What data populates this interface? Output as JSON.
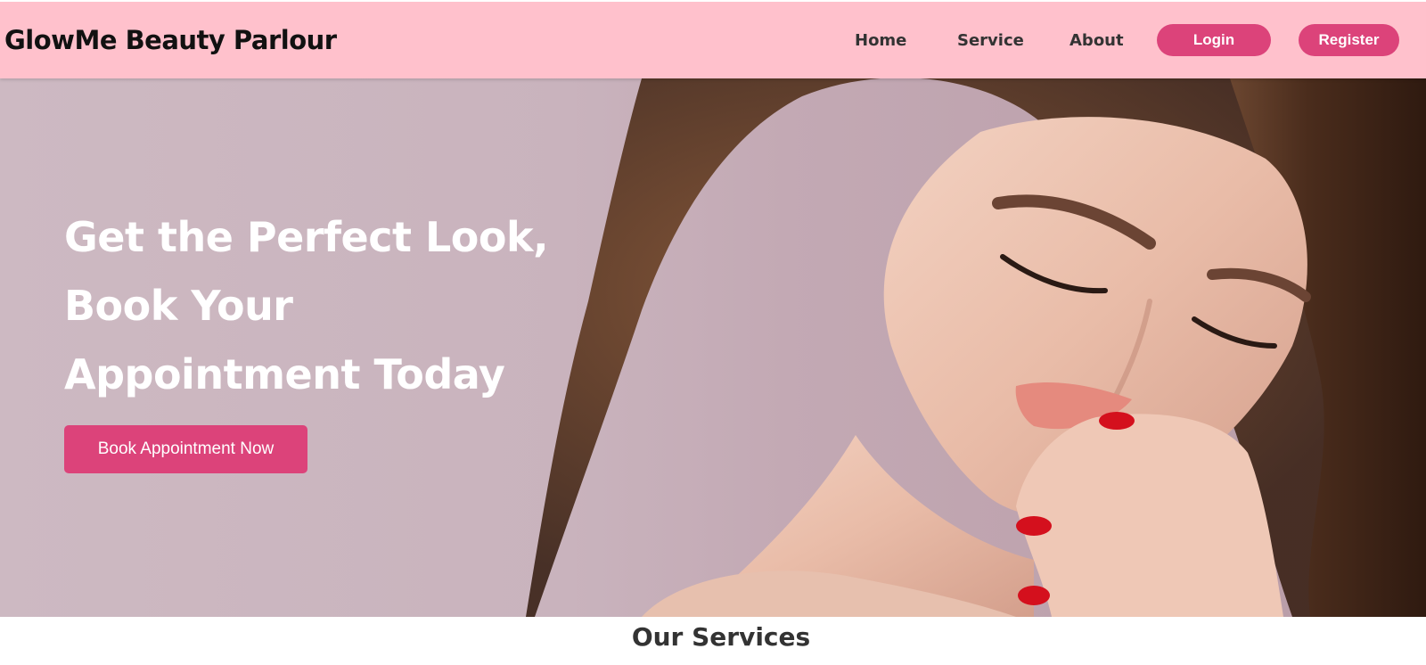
{
  "header": {
    "brand": "GlowMe Beauty Parlour",
    "nav": {
      "home": "Home",
      "service": "Service",
      "about": "About"
    },
    "login_label": "Login",
    "register_label": "Register"
  },
  "hero": {
    "title_lines": [
      "Get the Perfect Look,",
      "Book Your",
      "Appointment Today"
    ],
    "cta_label": "Book Appointment Now"
  },
  "services": {
    "heading": "Our Services"
  },
  "colors": {
    "navbar_bg": "#ffc1cc",
    "accent": "#dc437a",
    "hero_bg": "#c9b3bd"
  }
}
